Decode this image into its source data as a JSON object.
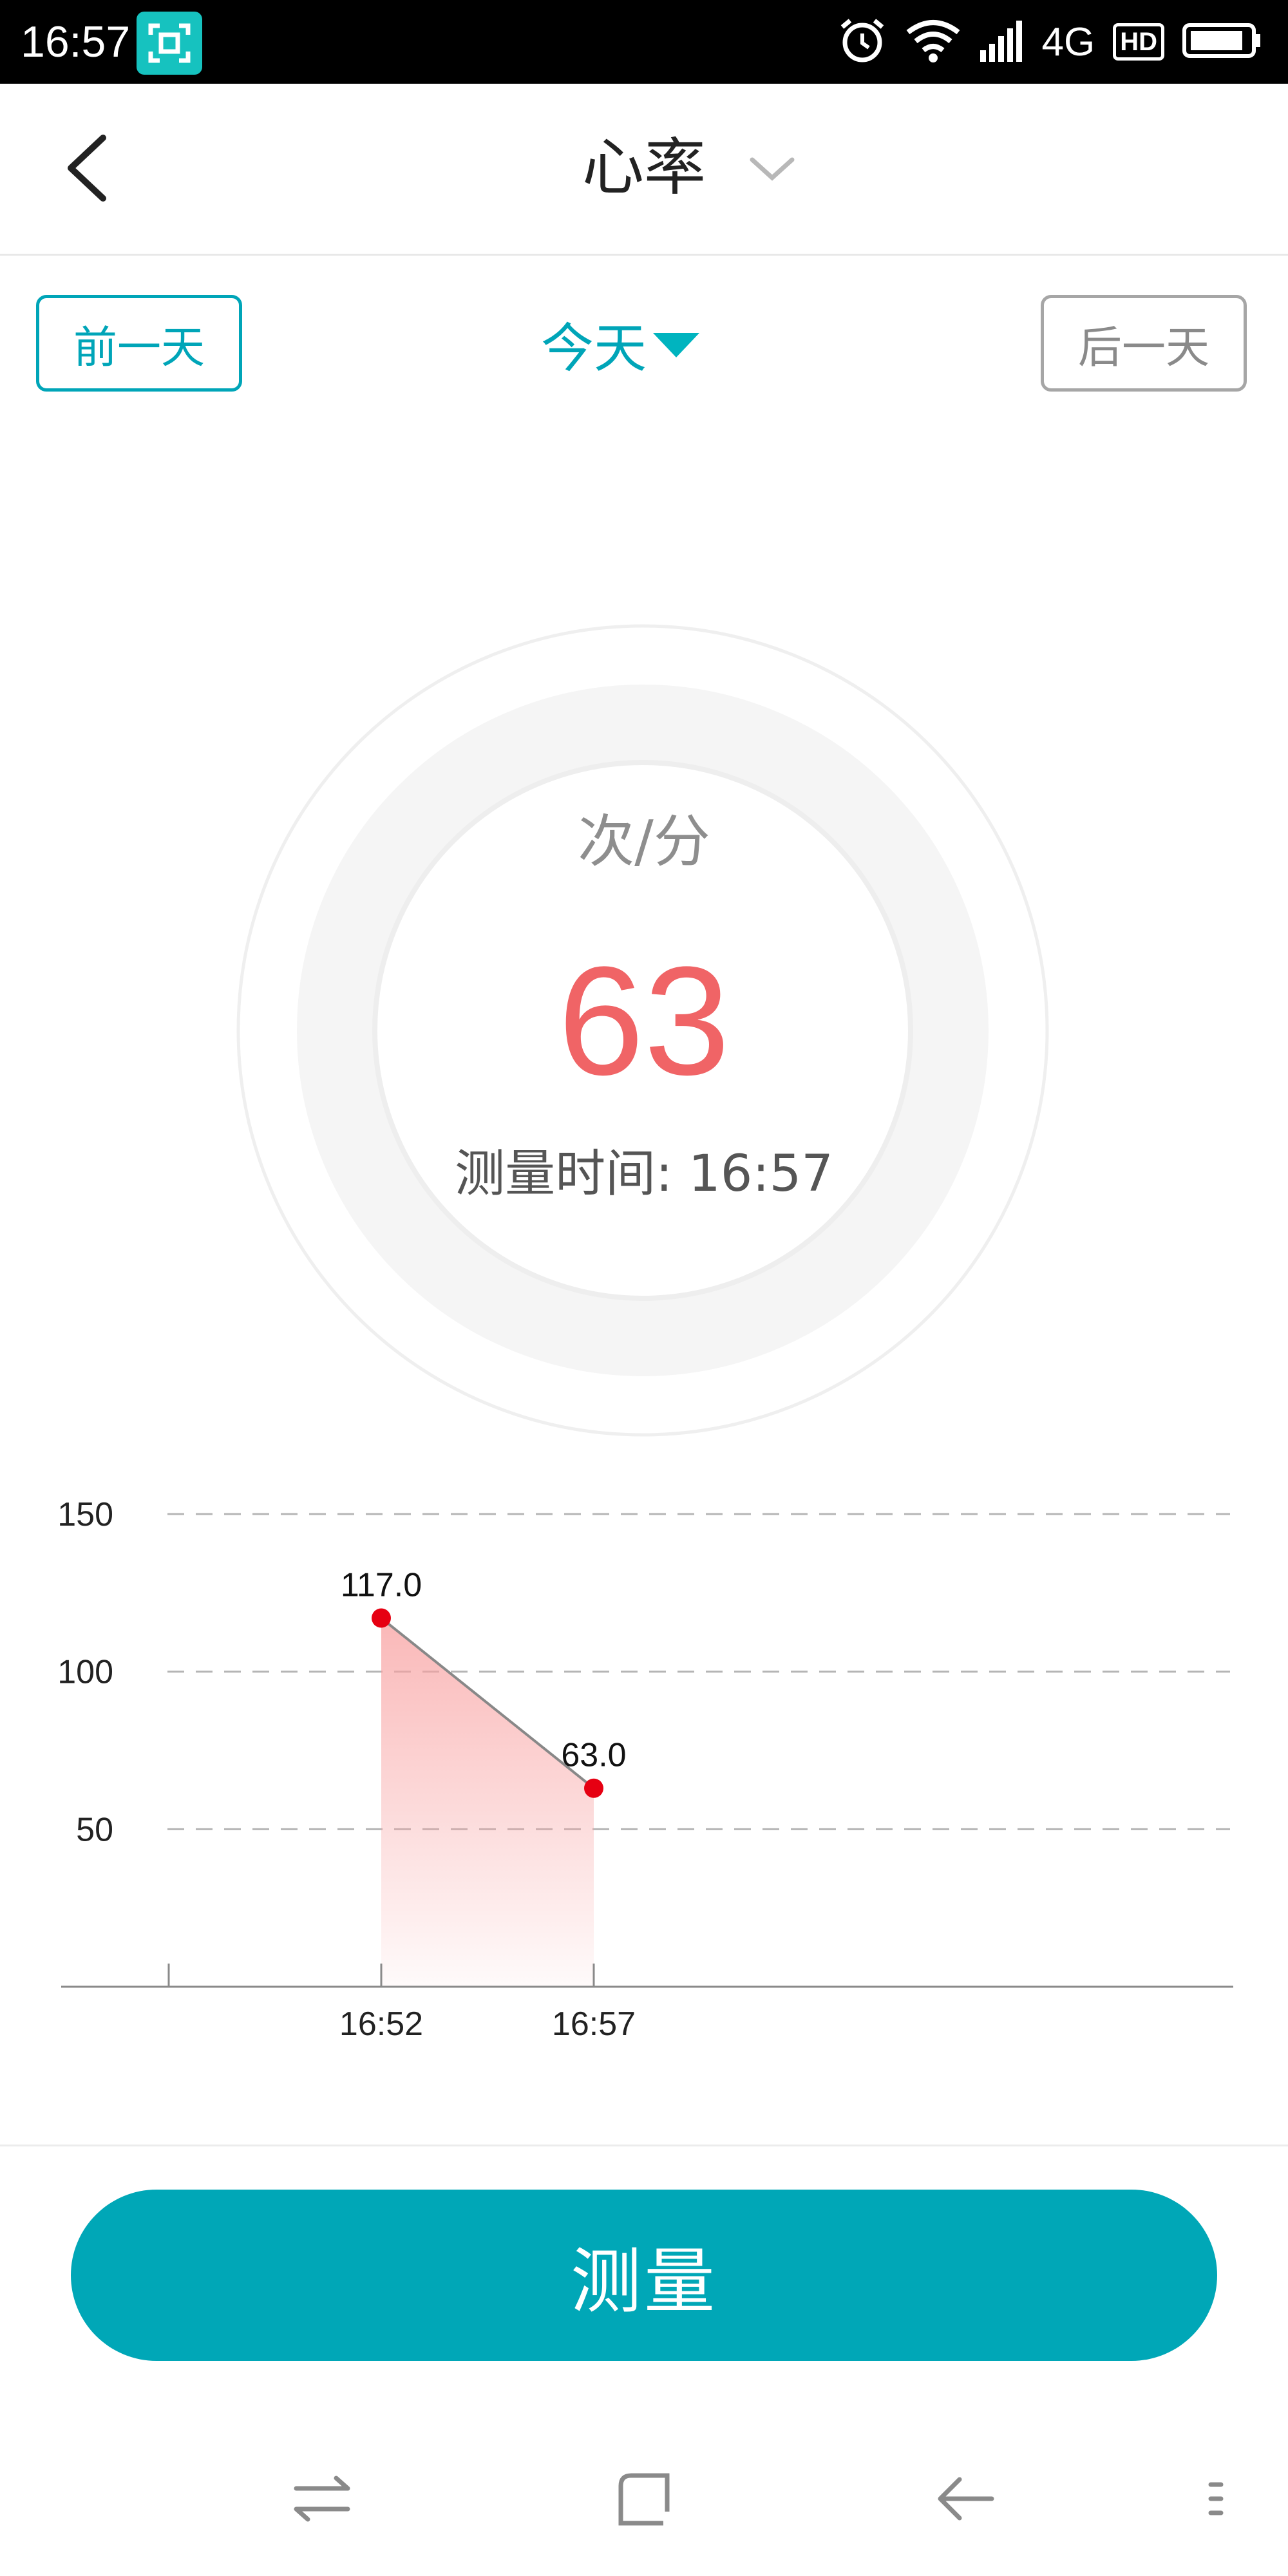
{
  "status_bar": {
    "time": "16:57",
    "network": "4G",
    "hd": "HD",
    "icons": [
      "screenshot-icon",
      "alarm-icon",
      "wifi-icon",
      "signal-icon",
      "battery-icon"
    ]
  },
  "header": {
    "title": "心率"
  },
  "date_nav": {
    "prev_label": "前一天",
    "current_label": "今天",
    "next_label": "后一天"
  },
  "gauge": {
    "unit": "次/分",
    "value": "63",
    "time_label": "测量时间: 16:57"
  },
  "chart_data": {
    "type": "area",
    "x": [
      "16:52",
      "16:57"
    ],
    "y": [
      117.0,
      63.0
    ],
    "data_labels": [
      "117.0",
      "63.0"
    ],
    "y_ticks": [
      "50",
      "100",
      "150"
    ],
    "ylim": [
      0,
      150
    ],
    "grid": true,
    "line_color": "#888888",
    "point_color": "#e60012",
    "fill_color": "#f8a0a0"
  },
  "measure_button": {
    "label": "测量"
  },
  "colors": {
    "accent": "#00a7b7",
    "value_red": "#f06466",
    "inactive_border": "#a6a6a6"
  },
  "system_nav": [
    "switch-apps-icon",
    "home-icon",
    "back-icon",
    "menu-icon"
  ]
}
